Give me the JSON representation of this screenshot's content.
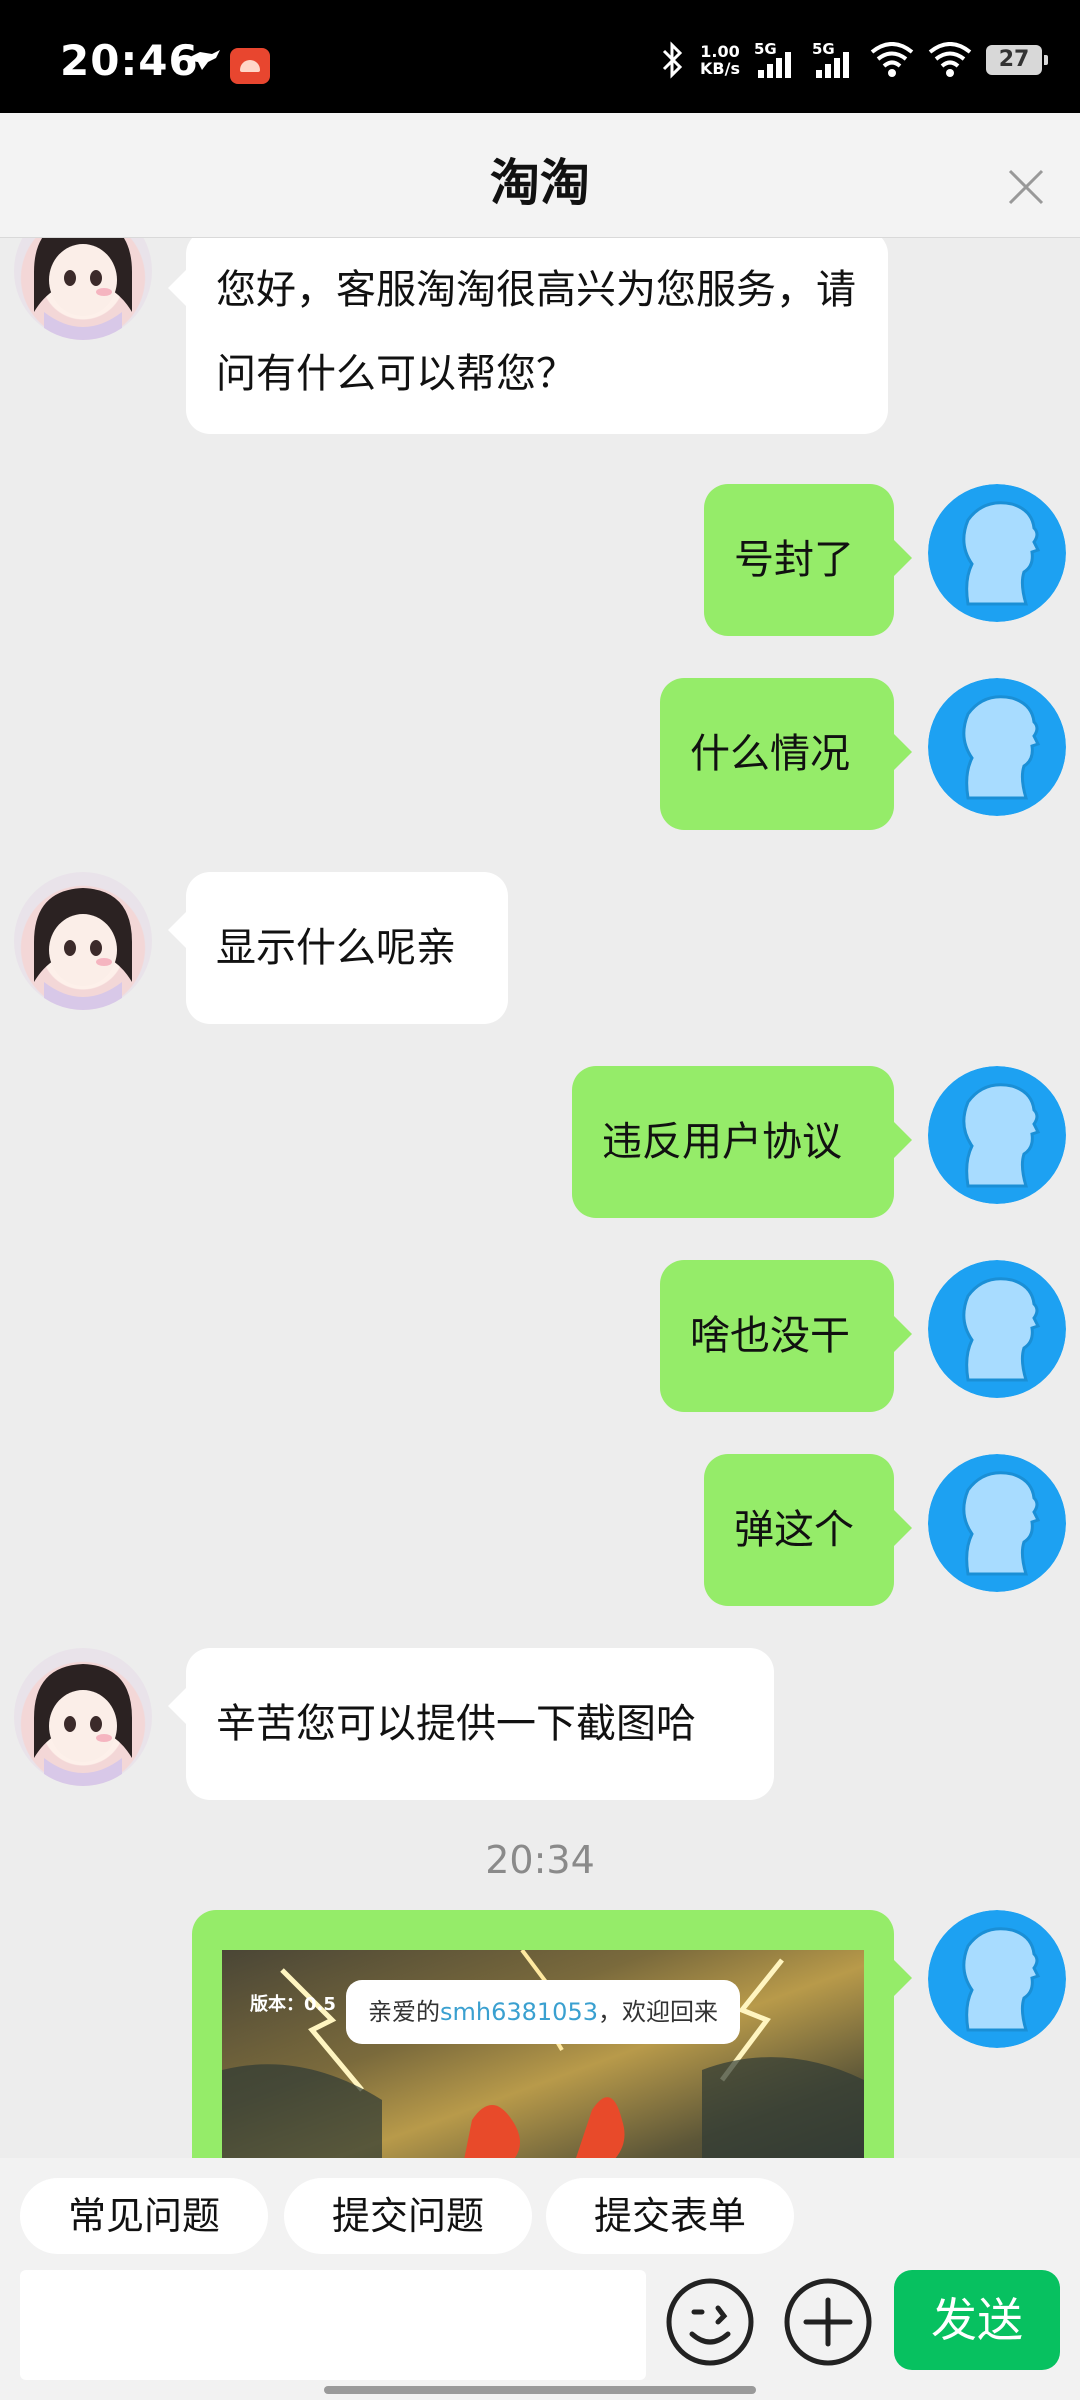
{
  "status_bar": {
    "time": "20:46",
    "speed_value": "1.00",
    "speed_unit": "KB/s",
    "net1": "5G",
    "net2": "5G",
    "battery": "27"
  },
  "header": {
    "title": "淘淘"
  },
  "chat": {
    "messages": [
      {
        "from": "agent",
        "text": "您好，客服淘淘很高兴为您服务，请问有什么可以帮您？"
      },
      {
        "from": "user",
        "text": "号封了"
      },
      {
        "from": "user",
        "text": "什么情况"
      },
      {
        "from": "agent",
        "text": "显示什么呢亲"
      },
      {
        "from": "user",
        "text": "违反用户协议"
      },
      {
        "from": "user",
        "text": "啥也没干"
      },
      {
        "from": "user",
        "text": "弹这个"
      },
      {
        "from": "agent",
        "text": "辛苦您可以提供一下截图哈"
      }
    ],
    "timestamp": "20:34",
    "screenshot": {
      "version_label": "版本：0.5",
      "toast_prefix": "亲爱的",
      "toast_username": "smh6381053",
      "toast_suffix": "，欢迎回来"
    }
  },
  "quick_replies": [
    "常见问题",
    "提交问题",
    "提交表单"
  ],
  "input": {
    "value": "",
    "send_label": "发送"
  },
  "icons": {
    "close": "close-icon",
    "emoji": "emoji-icon",
    "add": "plus-icon"
  },
  "colors": {
    "user_bubble": "#95ec69",
    "agent_bubble": "#ffffff",
    "send_button": "#07c160",
    "chat_background": "#ededed"
  }
}
